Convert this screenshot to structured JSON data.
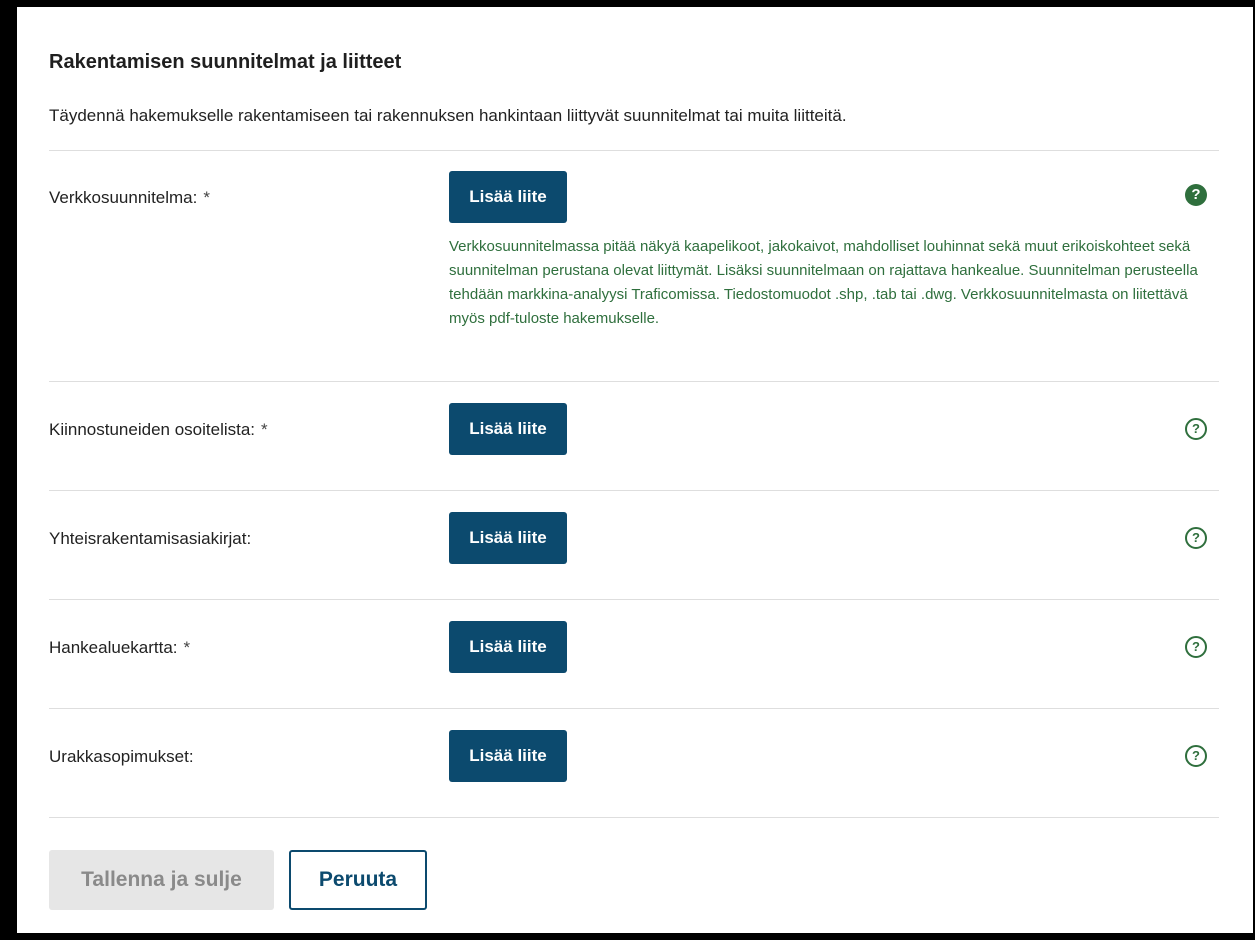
{
  "section": {
    "title": "Rakentamisen suunnitelmat ja liitteet",
    "intro": "Täydennä hakemukselle rakentamiseen tai rakennuksen hankintaan liittyvät suunnitelmat tai muita liitteitä."
  },
  "rows": [
    {
      "label": "Verkkosuunnitelma:",
      "required_mark": "*",
      "button_label": "Lisää liite",
      "help_icon": "question-circle-filled-icon",
      "help_text": "Verkkosuunnitelmassa pitää näkyä kaapelikoot, jakokaivot, mahdolliset louhinnat sekä muut erikoiskohteet sekä suunnitelman perustana olevat liittymät. Lisäksi suunnitelmaan on rajattava hankealue. Suunnitelman perusteella tehdään markkina-analyysi Traficomissa. Tiedostomuodot .shp, .tab tai .dwg. Verkkosuunnitelmasta on liitettävä myös pdf-tuloste hakemukselle."
    },
    {
      "label": "Kiinnostuneiden osoitelista:",
      "required_mark": "*",
      "button_label": "Lisää liite",
      "help_icon": "question-circle-outline-icon"
    },
    {
      "label": "Yhteisrakentamisasiakirjat:",
      "button_label": "Lisää liite",
      "help_icon": "question-circle-outline-icon"
    },
    {
      "label": "Hankealuekartta:",
      "required_mark": "*",
      "button_label": "Lisää liite",
      "help_icon": "question-circle-outline-icon"
    },
    {
      "label": "Urakkasopimukset:",
      "button_label": "Lisää liite",
      "help_icon": "question-circle-outline-icon"
    }
  ],
  "help_glyph": "?",
  "footer": {
    "save_label": "Tallenna ja sulje",
    "cancel_label": "Peruuta"
  },
  "colors": {
    "primary": "#0c4a6e",
    "help_green": "#2f6f3d",
    "disabled_bg": "#e6e6e6",
    "disabled_text": "#8a8a8a"
  }
}
